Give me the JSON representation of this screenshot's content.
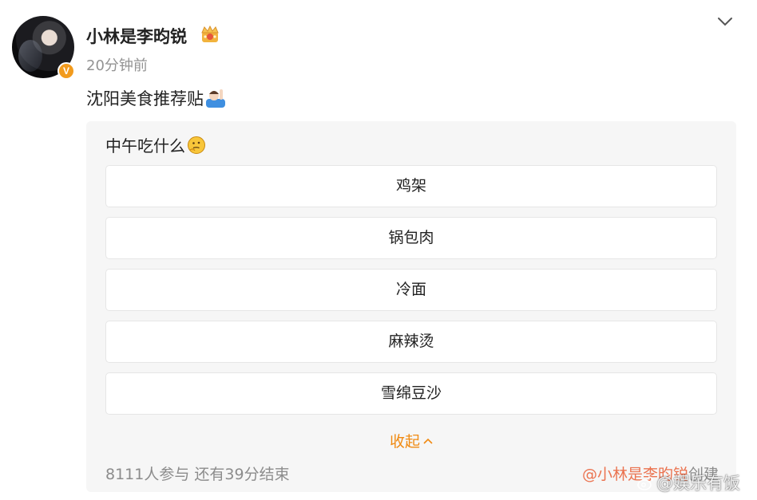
{
  "post": {
    "username": "小林是李昀锐",
    "verified_badge": "V",
    "time": "20分钟前",
    "text": "沈阳美食推荐贴",
    "icons": {
      "crown": "crown-badge-icon",
      "raise_hand": "person-raising-hand-icon",
      "more": "chevron-down-icon"
    }
  },
  "poll": {
    "question": "中午吃什么",
    "question_icon": "thinking-face-icon",
    "options": [
      {
        "label": "鸡架"
      },
      {
        "label": "锅包肉"
      },
      {
        "label": "冷面"
      },
      {
        "label": "麻辣烫"
      },
      {
        "label": "雪绵豆沙"
      }
    ],
    "collapse_label": "收起",
    "participants": "8111人参与 还有39分结束",
    "creator_mention": "@小林是李昀锐",
    "creator_suffix": "创建"
  },
  "watermark": {
    "text": "@娱乐有饭",
    "icon": "weibo-logo-icon"
  },
  "colors": {
    "accent": "#f08a12",
    "mention": "#eb7350",
    "badge": "#f29b1d",
    "card_bg": "#f6f6f6"
  }
}
